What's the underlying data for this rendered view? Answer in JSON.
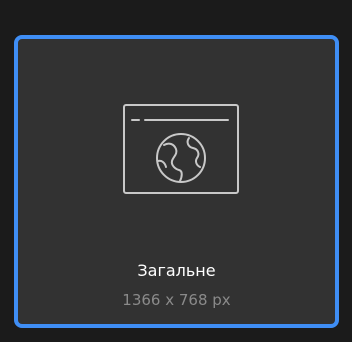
{
  "preset_card": {
    "title": "Загальне",
    "dimensions": "1366 x 768 px",
    "icon": "web-browser-globe-icon",
    "selected": true,
    "colors": {
      "background": "#1b1b1b",
      "card": "#323232",
      "border": "#3f8ef5",
      "title": "#ffffff",
      "subtitle": "#8a8a8a",
      "icon_stroke": "#c8c8c8"
    }
  }
}
